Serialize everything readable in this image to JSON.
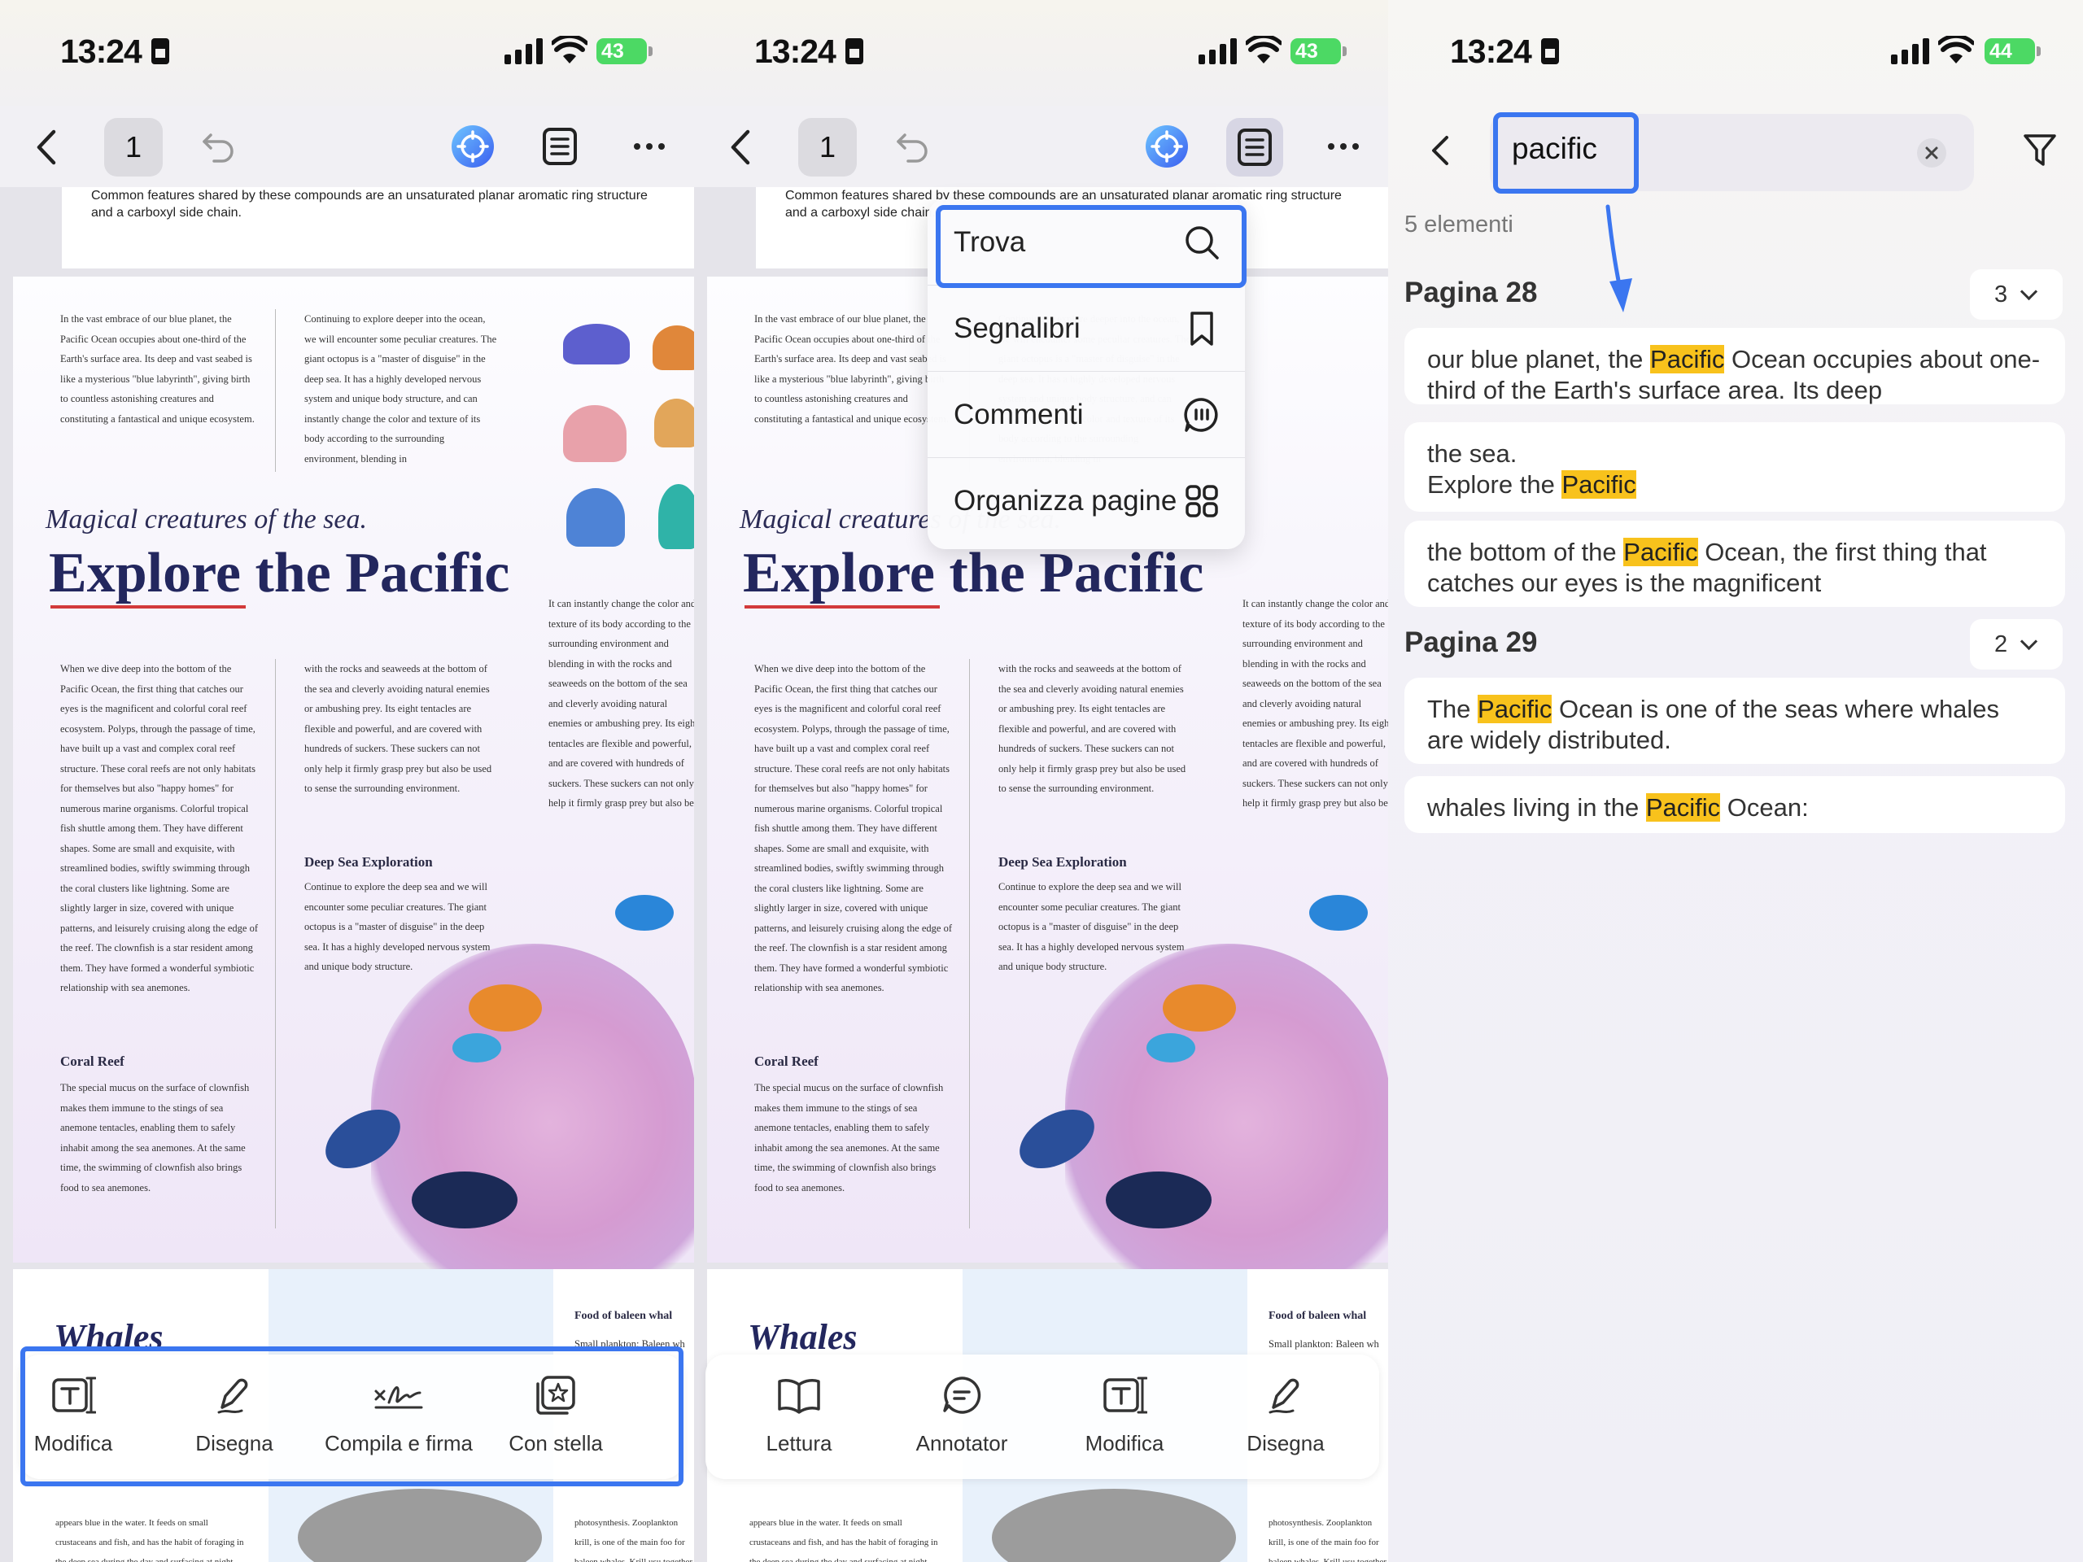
{
  "status": {
    "time": "13:24",
    "battery_left": "43",
    "battery_right": "44"
  },
  "toolbar": {
    "page_number": "1"
  },
  "document": {
    "top_caption": "Common features shared by these compounds are an unsaturated planar aromatic ring structure and a carboxyl side chain.",
    "col1_intro": "In the vast embrace of our blue planet, the Pacific Ocean occupies about one-third of the Earth's surface area. Its deep and vast seabed is like a mysterious \"blue labyrinth\", giving birth to countless astonishing creatures and constituting a fantastical and unique ecosystem.",
    "col2_intro": "Continuing to explore deeper into the ocean, we will encounter some peculiar creatures. The giant octopus is a \"master of disguise\" in the deep sea. It has a highly developed nervous system and unique body structure, and can instantly change the color and texture of its body according to the surrounding environment, blending in",
    "subtitle": "Magical creatures of the sea.",
    "title": "Explore the Pacific",
    "col1_main": "When we dive deep into the bottom of the Pacific Ocean, the first thing that catches our eyes is the magnificent and colorful coral reef ecosystem. Polyps, through the passage of time, have built up a vast and complex coral reef structure. These coral reefs are not only habitats for themselves but also \"happy homes\" for numerous marine organisms. Colorful tropical fish shuttle among them. They have different shapes. Some are small and exquisite, with streamlined bodies, swiftly swimming through the coral clusters like lightning. Some are slightly larger in size, covered with unique patterns, and leisurely cruising along the edge of the reef. The clownfish is a star resident among them. They have formed a wonderful symbiotic relationship with sea anemones.",
    "col2_main": "with the rocks and seaweeds at the bottom of the sea and cleverly avoiding natural enemies or ambushing prey. Its eight tentacles are flexible and powerful, and are covered with hundreds of suckers. These suckers can not only help it firmly grasp prey but also be used to sense the surrounding environment.",
    "col3_main": "It can instantly change the color and texture of its body according to the surrounding environment and blending in with the rocks and seaweeds on the bottom of the sea and cleverly avoiding natural enemies or ambushing prey. Its eight tentacles are flexible and powerful, and are covered with hundreds of suckers. These suckers can not only help it firmly grasp prey but also be used to sense the surrounding environment.",
    "deep_sea_head": "Deep Sea Exploration",
    "deep_sea_text": "Continue to explore the deep sea and we will encounter some peculiar creatures. The giant octopus is a \"master of disguise\" in the deep sea. It has a highly developed nervous system and unique body structure.",
    "coral_head": "Coral Reef",
    "coral_text": "The special mucus on the surface of clownfish makes them immune to the stings of sea anemone tentacles, enabling them to safely inhabit among the sea anemones. At the same time, the swimming of clownfish also brings food to sea anemones.",
    "whales_title": "Whales",
    "baleen_head": "Food of baleen whal",
    "baleen_text": "Small plankton: Baleen wh",
    "bottom_left_text": "appears blue in the water. It feeds on small crustaceans and fish, and has the habit of foraging in the deep sea during the day and surfacing at night.",
    "bottom_right_text": "photosynthesis. Zooplankton krill, is one of the main foo for baleen whales. Krill usu together to form large grou"
  },
  "bottom_bar_1": [
    {
      "label": "Modifica",
      "icon": "text-edit-icon"
    },
    {
      "label": "Disegna",
      "icon": "pen-icon"
    },
    {
      "label": "Compila e firma",
      "icon": "signature-icon"
    },
    {
      "label": "Con stella",
      "icon": "star-icon"
    }
  ],
  "bottom_bar_2": [
    {
      "label": "Lettura",
      "icon": "book-icon"
    },
    {
      "label": "Annotator",
      "icon": "comment-icon"
    },
    {
      "label": "Modifica",
      "icon": "text-edit-icon"
    },
    {
      "label": "Disegna",
      "icon": "pen-icon"
    }
  ],
  "menu": [
    {
      "label": "Trova",
      "icon": "search-icon"
    },
    {
      "label": "Segnalibri",
      "icon": "bookmark-icon"
    },
    {
      "label": "Commenti",
      "icon": "comments-icon"
    },
    {
      "label": "Organizza pagine",
      "icon": "grid-icon"
    }
  ],
  "search": {
    "query": "pacific",
    "count_label": "5 elementi",
    "groups": [
      {
        "page": "Pagina 28",
        "count": "3",
        "results": [
          {
            "before": "our blue planet, the ",
            "match": "Pacific",
            "after": " Ocean occupies about one-third of the Earth's surface area. Its deep"
          },
          {
            "before": "the sea.\nExplore the ",
            "match": "Pacific",
            "after": ""
          },
          {
            "before": "the bottom of the ",
            "match": "Pacific",
            "after": " Ocean, the first thing that catches our eyes is the magnificent"
          }
        ]
      },
      {
        "page": "Pagina 29",
        "count": "2",
        "results": [
          {
            "before": "The ",
            "match": "Pacific",
            "after": " Ocean is one of the seas where whales are widely distributed."
          },
          {
            "before": "whales living in the ",
            "match": "Pacific",
            "after": " Ocean:"
          }
        ]
      }
    ]
  },
  "colors": {
    "accent": "#3b76f0",
    "highlight": "#f8c21c",
    "title_color": "#23275e",
    "underline": "#d23a3a"
  }
}
